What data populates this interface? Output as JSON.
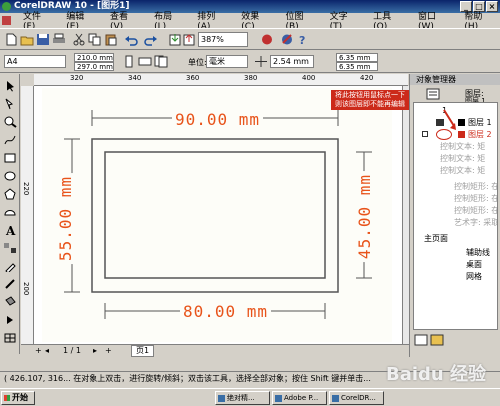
{
  "window": {
    "title": "CorelDRAW 10 - [图形1]"
  },
  "menu": [
    "文件(F)",
    "编辑(E)",
    "查看(V)",
    "布局(L)",
    "排列(A)",
    "效果(C)",
    "位图(B)",
    "文字(T)",
    "工具(O)",
    "窗口(W)",
    "帮助(H)"
  ],
  "toolbar": {
    "zoom": "387%"
  },
  "propbar": {
    "paper": "A4",
    "width": "210.0 mm",
    "height": "297.0 mm",
    "unit_label": "单位:",
    "unit": "毫米",
    "nudge": "2.54 mm",
    "dup_x": "6.35 mm",
    "dup_y": "6.35 mm"
  },
  "ruler": {
    "h_ticks": [
      "320",
      "340",
      "360",
      "380",
      "400",
      "420"
    ],
    "v_ticks": [
      "220",
      "200"
    ]
  },
  "drawing": {
    "top_dim": "90.00 mm",
    "left_dim": "55.00 mm",
    "right_dim": "45.00 mm",
    "bottom_dim": "80.00 mm"
  },
  "page_nav": {
    "counter": "1 / 1",
    "tab": "页1"
  },
  "docker": {
    "title": "对象管理器",
    "header": "图层:",
    "header_value": "图层 1",
    "rows": [
      "图层 1",
      "图层 2",
      "控制文本: 矩",
      "控制文本: 矩",
      "控制文本: 矩",
      "控制矩形: 在",
      "控制矩形: 在",
      "控制矩形: 在",
      "艺术字: 采取",
      "主页面",
      "辅助线",
      "桌面",
      "网格"
    ],
    "row_bullet": "1"
  },
  "callout": "将此按钮用鼠标点一下 则该图层即不能再编辑",
  "status": "( 426.107, 316...      在对象上双击，进行旋转/倾斜；双击该工具，选择全部对象；按住 Shift 键并单击...",
  "taskbar": {
    "start": "开始",
    "tasks": [
      "...",
      "绝对精...",
      "Adobe P...",
      "CorelDR...",
      "..."
    ]
  },
  "watermark": "Baidu 经验",
  "colors": {
    "accent": "#e8531a",
    "titlebar": "#0a246a",
    "callout": "#cc2a1a"
  }
}
